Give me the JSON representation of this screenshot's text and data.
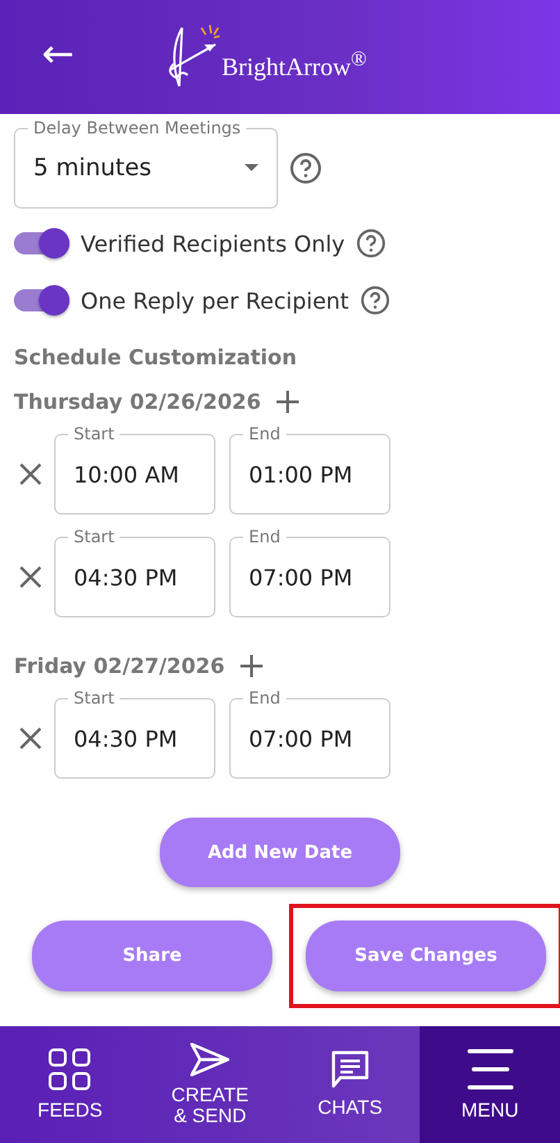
{
  "header": {
    "back": "←",
    "logo": "BrightArrow$^{®}$"
  },
  "delay": {
    "label": "Delay Between Meetings",
    "value": "5 minutes"
  },
  "toggles": [
    {
      "label": "Verified Recipients Only",
      "on": true
    },
    {
      "label": "One Reply per Recipient",
      "on": true
    }
  ],
  "schedule": {
    "title": "Schedule Customization",
    "days": [
      {
        "date": "Thursday 02/26/2026",
        "slots": [
          {
            "start_label": "Start",
            "start": "10:00 AM",
            "end_label": "End",
            "end": "01:00 PM"
          },
          {
            "start_label": "Start",
            "start": "04:30 PM",
            "end_label": "End",
            "end": "07:00 PM"
          }
        ]
      },
      {
        "date": "Friday 02/27/2026",
        "slots": [
          {
            "start_label": "Start",
            "start": "04:30 PM",
            "end_label": "End",
            "end": "07:00 PM"
          }
        ]
      }
    ]
  },
  "add_date": "Add New Date",
  "actions": [
    {
      "label": "Share",
      "highlighted": false
    },
    {
      "label": "Save Changes",
      "highlighted": true
    }
  ],
  "nav": [
    {
      "kind": "feeds",
      "label": "FEEDS",
      "selected": false
    },
    {
      "kind": "send",
      "label": "CREATE\n& SEND",
      "selected": false
    },
    {
      "kind": "chats",
      "label": "CHATS",
      "selected": false
    },
    {
      "kind": "menu",
      "label": "MENU",
      "selected": true
    }
  ]
}
